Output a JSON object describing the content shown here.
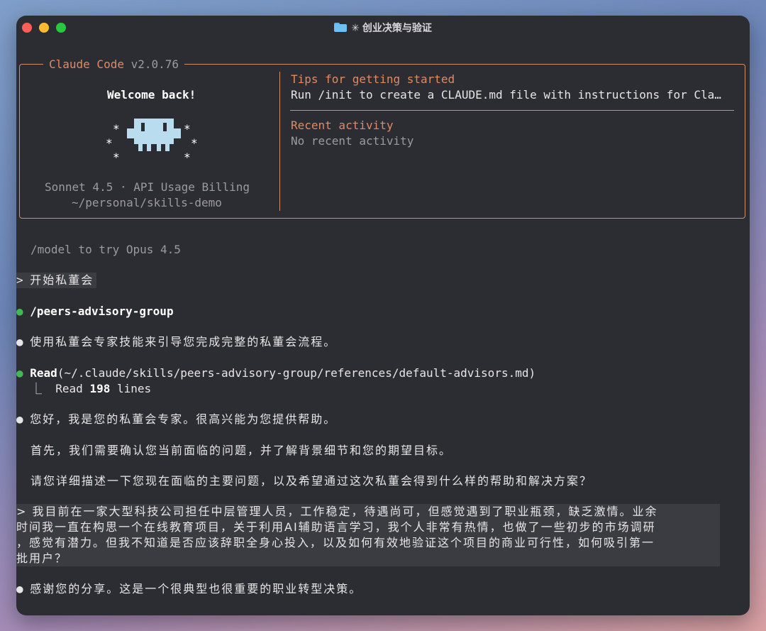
{
  "window": {
    "title": "创业决策与验证",
    "spinner": "✳"
  },
  "welcome_box": {
    "app_name": "Claude Code",
    "version": "v2.0.76",
    "greeting": "Welcome back!",
    "model_line": "Sonnet 4.5 · API Usage Billing",
    "path": "~/personal/skills-demo",
    "tips_heading": "Tips for getting started",
    "tips_text": "Run /init to create a CLAUDE.md file with instructions for Cla…",
    "recent_heading": "Recent activity",
    "recent_text": "No recent activity"
  },
  "transcript": {
    "hint": "/model to try Opus 4.5",
    "prompt1_marker": ">",
    "prompt1": "开始私董会",
    "skill_call": "/peers-advisory-group",
    "msg1": "使用私董会专家技能来引导您完成完整的私董会流程。",
    "read_tool": "Read",
    "read_path": "(~/.claude/skills/peers-advisory-group/references/default-advisors.md)",
    "read_result_prefix": "⎿  Read ",
    "read_count": "198",
    "read_result_suffix": " lines",
    "msg2": "您好，我是您的私董会专家。很高兴能为您提供帮助。",
    "msg3": "首先，我们需要确认您当前面临的问题，并了解背景细节和您的期望目标。",
    "msg4": "请您详细描述一下您现在面临的主要问题，以及希望通过这次私董会得到什么样的帮助和解决方案？",
    "user_msg_line1": "> 我目前在一家大型科技公司担任中层管理人员，工作稳定，待遇尚可，但感觉遇到了职业瓶颈，缺乏激情。业余",
    "user_msg_line2": "时间我一直在构思一个在线教育项目，关于利用AI辅助语言学习，我个人非常有热情，也做了一些初步的市场调研",
    "user_msg_line3": "，感觉有潜力。但我不知道是否应该辞职全身心投入，以及如何有效地验证这个项目的商业可行性，如何吸引第一",
    "user_msg_line4": "批用户？",
    "msg5": "感谢您的分享。这是一个很典型也很重要的职业转型决策。",
    "bullet": "●"
  },
  "colors": {
    "accent": "#e08a63",
    "success": "#3fb950",
    "background": "#2c2d33"
  }
}
